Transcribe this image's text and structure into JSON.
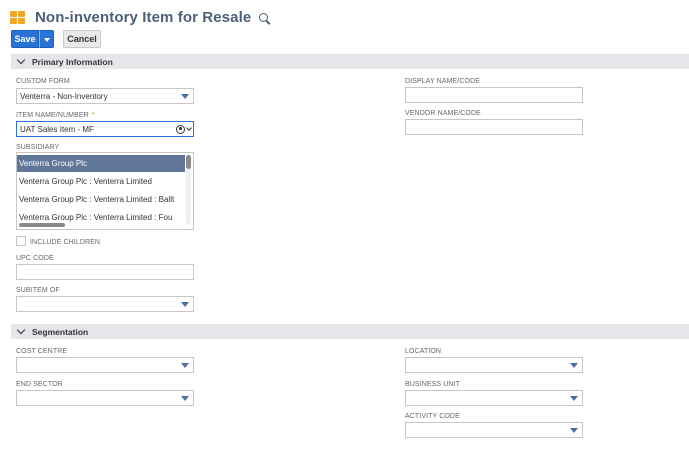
{
  "page": {
    "title": "Non-inventory Item for Resale",
    "title_icon": "records-grid-icon",
    "search_icon": "search-icon"
  },
  "toolbar": {
    "save_label": "Save",
    "cancel_label": "Cancel"
  },
  "sections": {
    "primary": {
      "label": "Primary Information"
    },
    "segmentation": {
      "label": "Segmentation"
    }
  },
  "primary": {
    "custom_form": {
      "label": "CUSTOM FORM",
      "value": "Venterra - Non-Inventory"
    },
    "item_name": {
      "label": "ITEM NAME/NUMBER",
      "required_mark": "*",
      "value": "UAT Sales Item - MF"
    },
    "subsidiary": {
      "label": "SUBSIDIARY",
      "options": [
        "Venterra Group Plc",
        "Venterra Group Plc : Venterra Limited",
        "Venterra Group Plc : Venterra Limited : Ballt",
        "Venterra Group Plc : Venterra Limited : Fou"
      ],
      "selected_index": 0
    },
    "include_children": {
      "label": "INCLUDE CHILDREN",
      "checked": false
    },
    "upc_code": {
      "label": "UPC CODE",
      "value": ""
    },
    "subitem_of": {
      "label": "SUBITEM OF",
      "value": ""
    },
    "display_name": {
      "label": "DISPLAY NAME/CODE",
      "value": ""
    },
    "vendor_name": {
      "label": "VENDOR NAME/CODE",
      "value": ""
    }
  },
  "segmentation": {
    "cost_centre": {
      "label": "COST CENTRE",
      "value": ""
    },
    "end_sector": {
      "label": "END SECTOR",
      "value": ""
    },
    "location": {
      "label": "LOCATION",
      "value": ""
    },
    "business_unit": {
      "label": "BUSINESS UNIT",
      "value": ""
    },
    "activity_code": {
      "label": "ACTIVITY CODE",
      "value": ""
    }
  },
  "colors": {
    "accent": "#2a73d6",
    "title": "#4d5f79",
    "selected_option": "#607799",
    "section_bar": "#e4e6ea"
  }
}
